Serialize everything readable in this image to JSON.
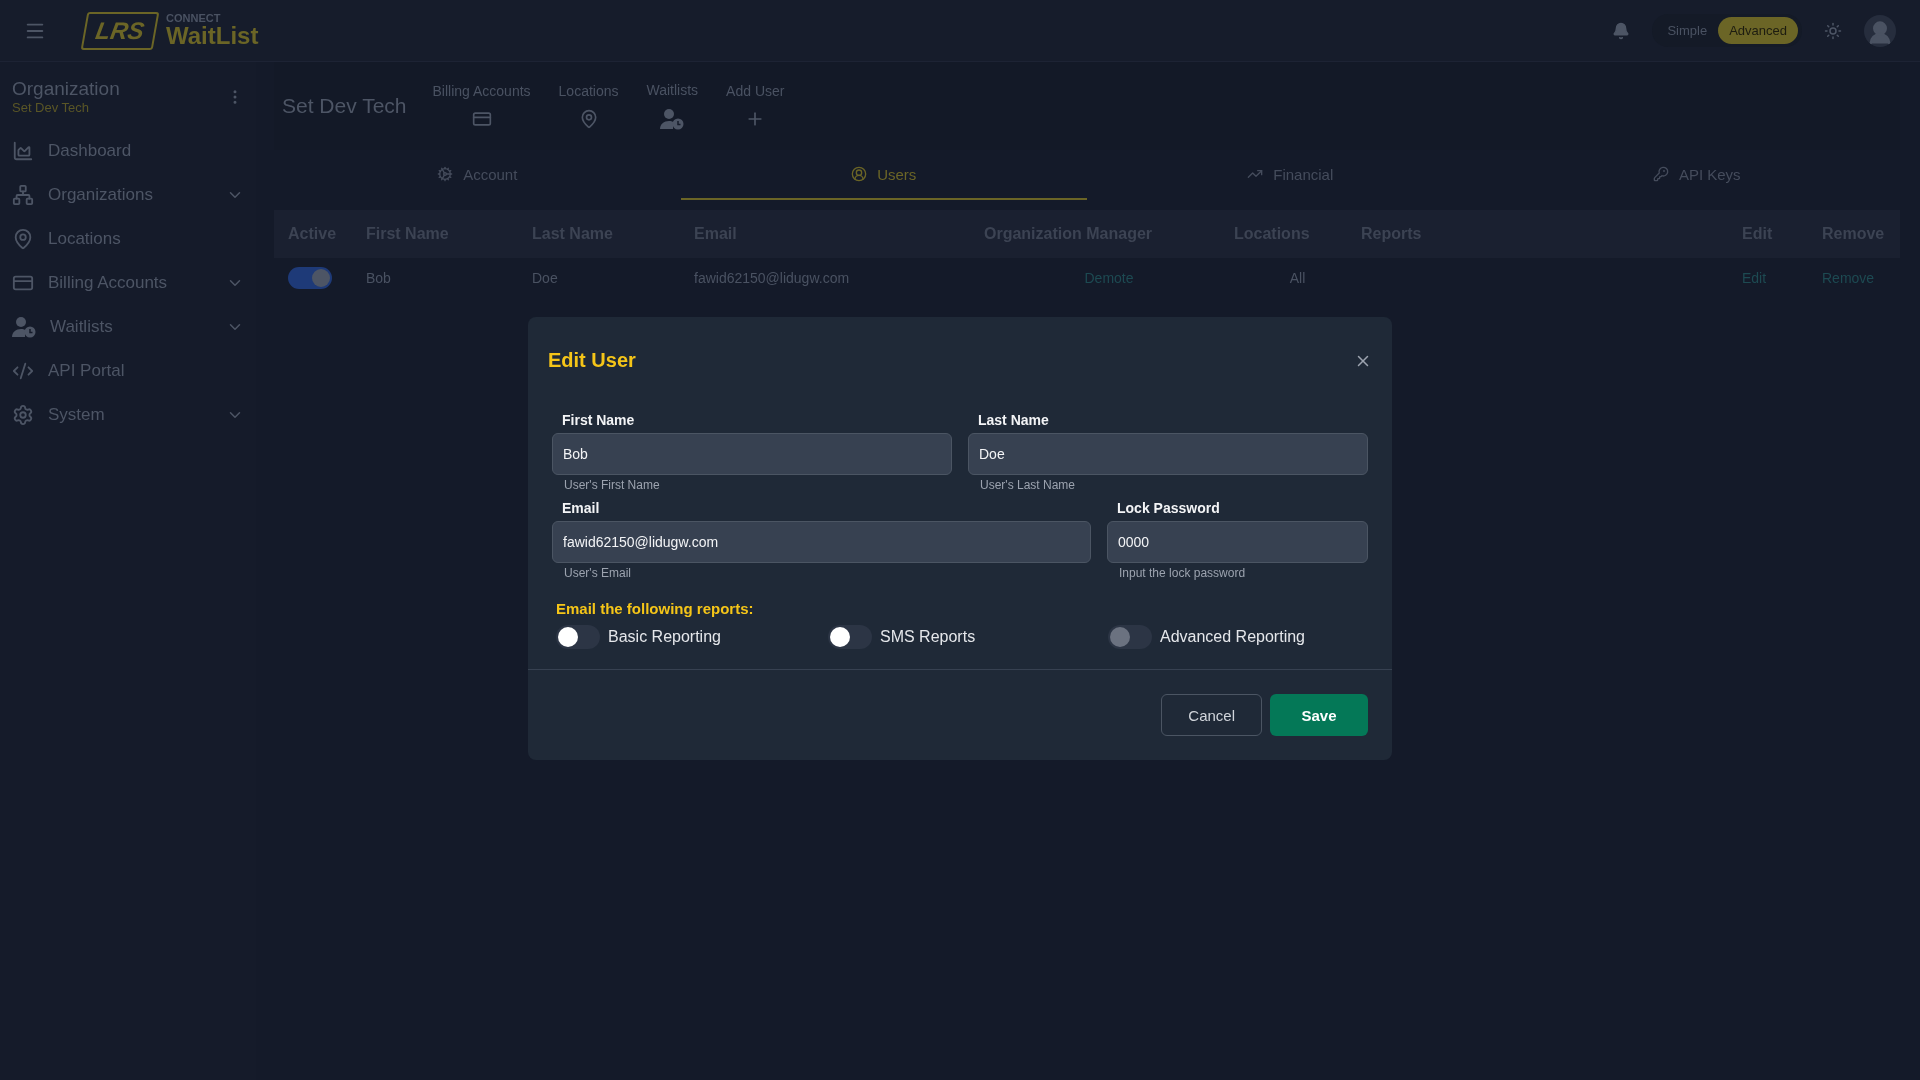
{
  "header": {
    "logo": {
      "mark": "LRS",
      "over": "CONNECT",
      "name": "WaitList"
    },
    "mode_switch": [
      {
        "label": "Simple",
        "selected": false
      },
      {
        "label": "Advanced",
        "selected": true
      }
    ]
  },
  "sidebar": {
    "heading": "Organization",
    "subheading": "Set Dev Tech",
    "items": [
      {
        "label": "Dashboard",
        "expandable": false
      },
      {
        "label": "Organizations",
        "expandable": true
      },
      {
        "label": "Locations",
        "expandable": false
      },
      {
        "label": "Billing Accounts",
        "expandable": true
      },
      {
        "label": "Waitlists",
        "expandable": true
      },
      {
        "label": "API Portal",
        "expandable": false
      },
      {
        "label": "System",
        "expandable": true
      }
    ]
  },
  "page": {
    "title": "Set Dev Tech",
    "shortcuts": [
      {
        "label": "Billing Accounts"
      },
      {
        "label": "Locations"
      },
      {
        "label": "Waitlists"
      },
      {
        "label": "Add User"
      }
    ]
  },
  "tabs": [
    {
      "label": "Account",
      "selected": false
    },
    {
      "label": "Users",
      "selected": true
    },
    {
      "label": "Financial",
      "selected": false
    },
    {
      "label": "API Keys",
      "selected": false
    }
  ],
  "table": {
    "columns": [
      "Active",
      "First Name",
      "Last Name",
      "Email",
      "Organization Manager",
      "Locations",
      "Reports",
      "Edit",
      "Remove"
    ],
    "rows": [
      {
        "active": true,
        "first_name": "Bob",
        "last_name": "Doe",
        "email": "fawid62150@lidugw.com",
        "manager_action": "Demote",
        "locations": "All",
        "edit": "Edit",
        "remove": "Remove"
      }
    ]
  },
  "dialog": {
    "title": "Edit User",
    "fields": [
      {
        "label": "First Name",
        "value": "Bob",
        "helper": "User's First Name"
      },
      {
        "label": "Last Name",
        "value": "Doe",
        "helper": "User's Last Name"
      },
      {
        "label": "Email",
        "value": "fawid62150@lidugw.com",
        "helper": "User's Email"
      },
      {
        "label": "Lock Password",
        "value": "0000",
        "helper": "Input the lock password"
      }
    ],
    "reports_heading": "Email the following reports:",
    "reports": [
      {
        "label": "Basic Reporting",
        "on": false,
        "disabled": false
      },
      {
        "label": "SMS Reports",
        "on": false,
        "disabled": false
      },
      {
        "label": "Advanced Reporting",
        "on": false,
        "disabled": true
      }
    ],
    "buttons": {
      "cancel": "Cancel",
      "save": "Save"
    }
  }
}
